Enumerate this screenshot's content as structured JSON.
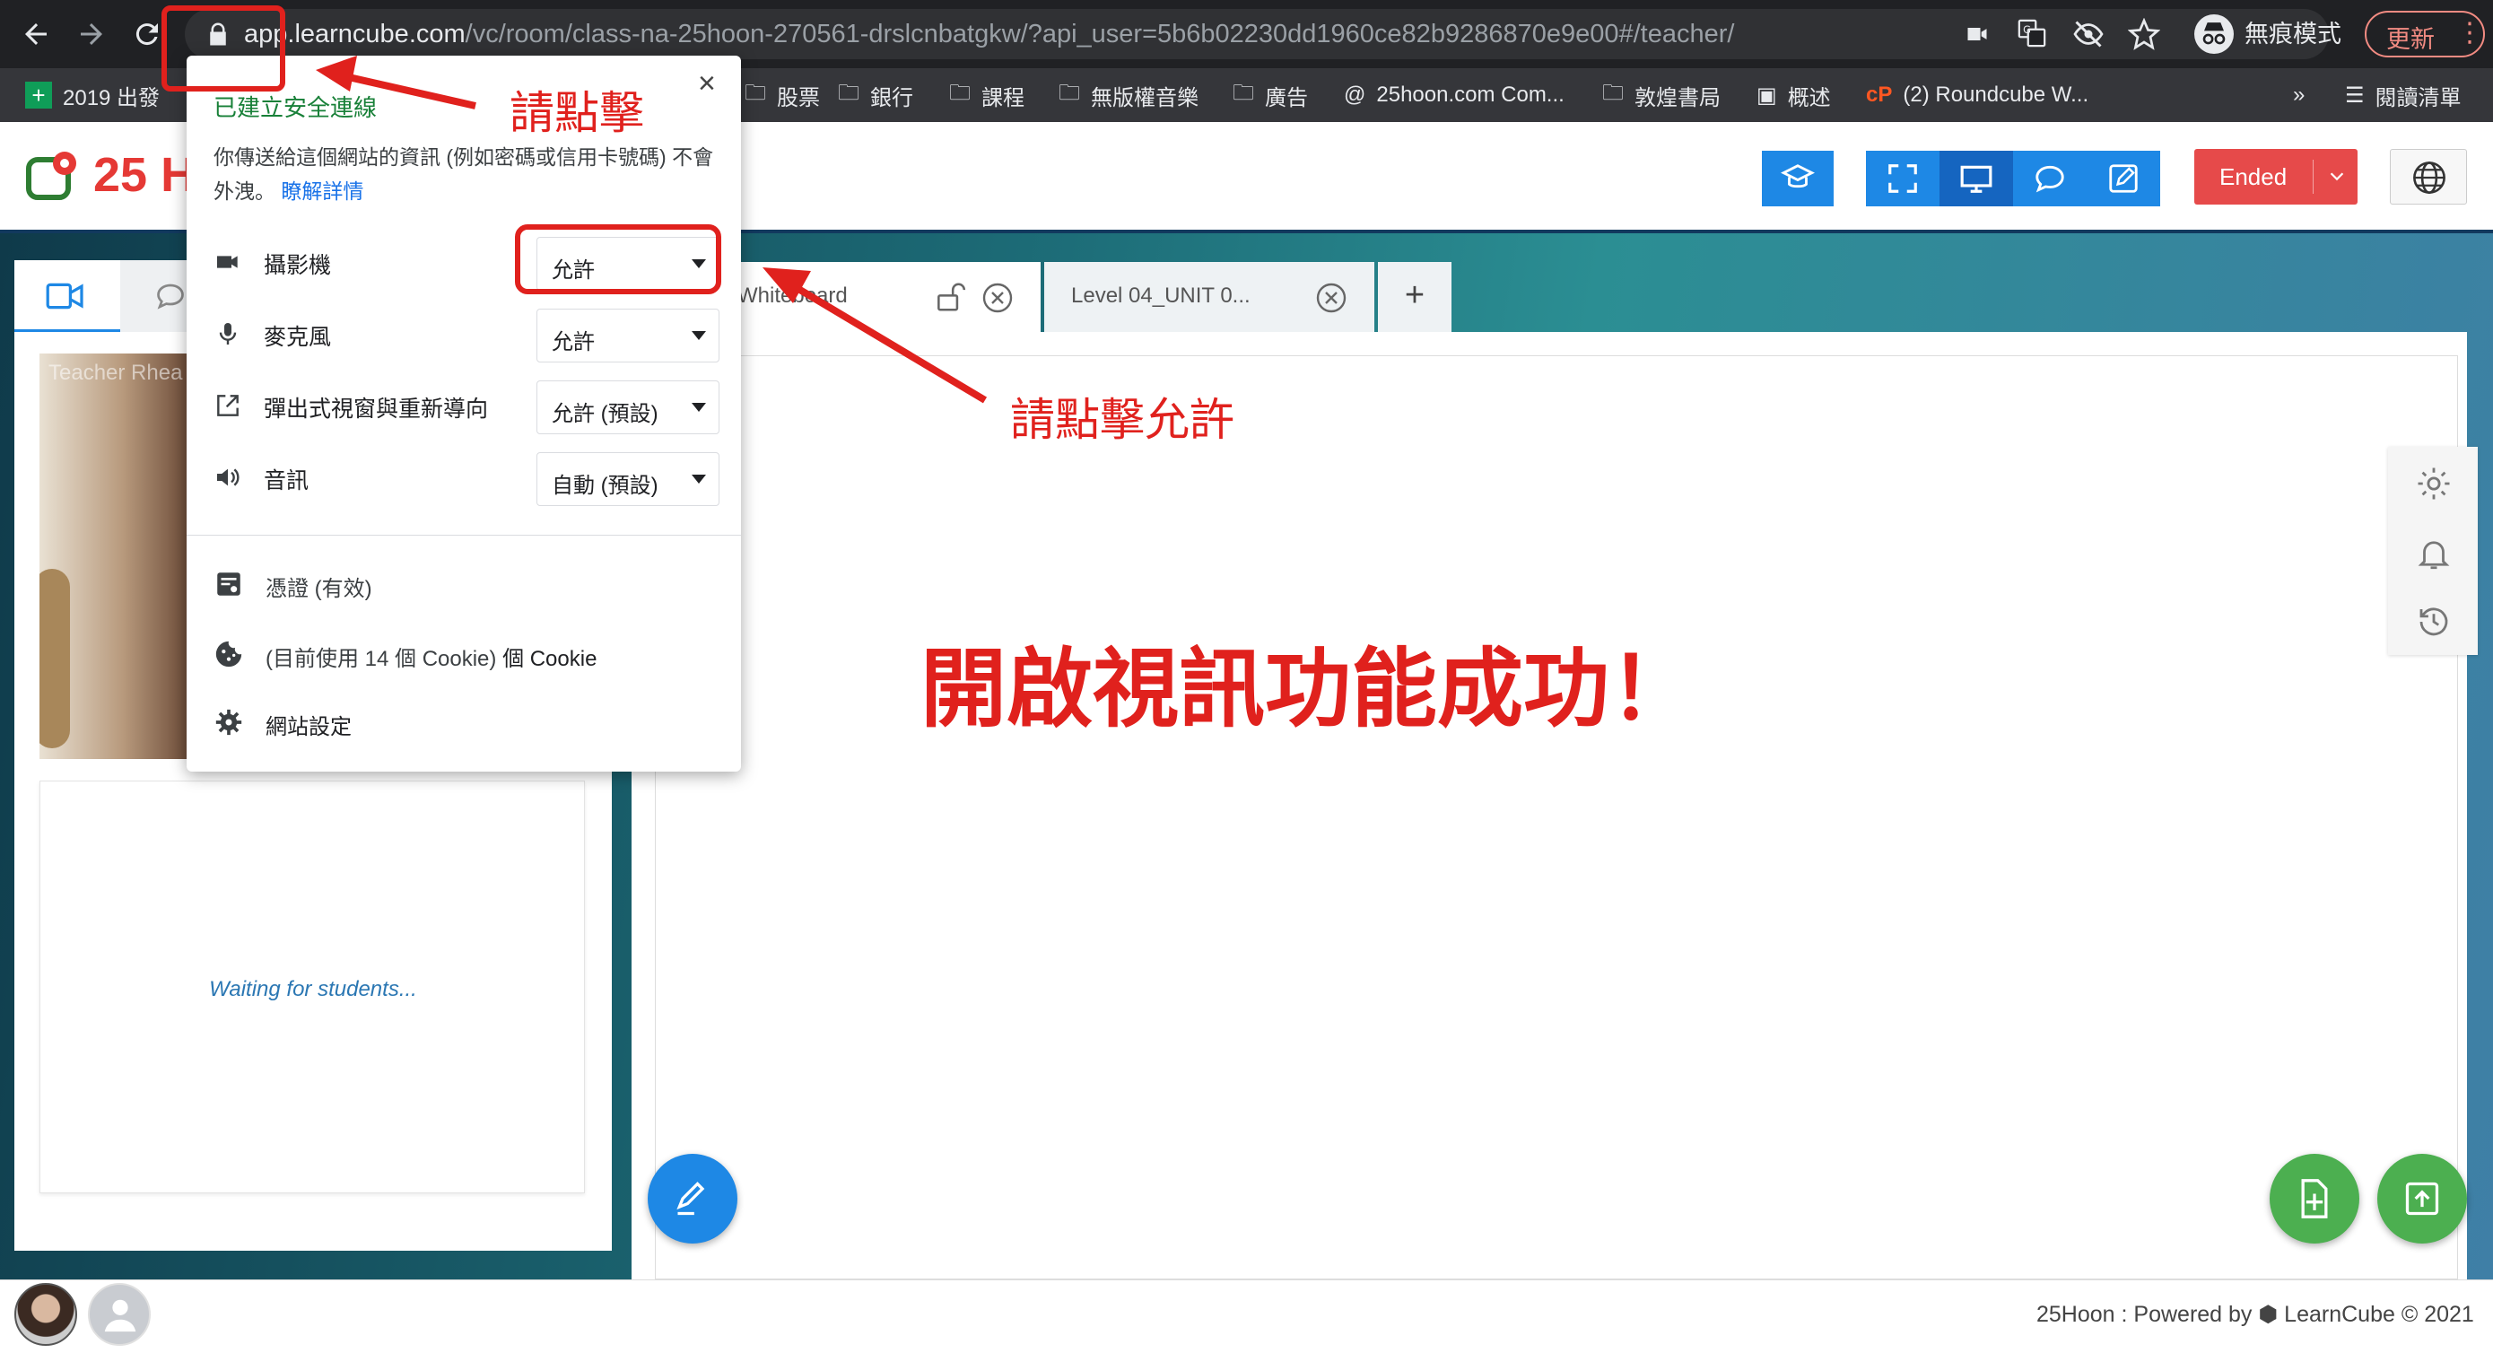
{
  "browser": {
    "url_host": "app.learncube.com",
    "url_path": "/vc/room/class-na-25hoon-270561-drslcnbatgkw/?api_user=5b6b02230dd1960ce82b9286870e9e00#/teacher/",
    "incognito_label": "無痕模式",
    "update_label": "更新",
    "bookmarks": [
      "2019 出發",
      "股票",
      "銀行",
      "課程",
      "無版權音樂",
      "廣告",
      "25hoon.com Com...",
      "敦煌書局",
      "概述",
      "(2) Roundcube W..."
    ],
    "overflow_label": "»",
    "reading_list_label": "閱讀清單"
  },
  "popup": {
    "title": "已建立安全連線",
    "description": "你傳送給這個網站的資訊 (例如密碼或信用卡號碼) 不會外洩。",
    "learn_more": "瞭解詳情",
    "permissions": [
      {
        "label": "攝影機",
        "value": "允許",
        "icon": "camera-icon"
      },
      {
        "label": "麥克風",
        "value": "允許",
        "icon": "microphone-icon"
      },
      {
        "label": "彈出式視窗與重新導向",
        "value": "允許 (預設)",
        "icon": "popup-icon"
      },
      {
        "label": "音訊",
        "value": "自動 (預設)",
        "icon": "speaker-icon"
      }
    ],
    "certificate": "憑證 (有效)",
    "cookies_prefix": "(目前使用 14 個 Cookie)",
    "cookies_suffix": "個 Cookie",
    "site_settings": "網站設定"
  },
  "app": {
    "logo_text": "25 H",
    "ended_label": "Ended",
    "tabs": [
      {
        "label": "Whiteboard"
      },
      {
        "label": "Level 04_UNIT 0..."
      }
    ],
    "add_tab": "+",
    "teacher_label": "Teacher Rhea",
    "waiting_text": "Waiting for students...",
    "footer_text": "25Hoon : Powered by ",
    "footer_brand": "LearnCube © 2021"
  },
  "annotations": {
    "click_here": "請點擊",
    "click_allow": "請點擊允許",
    "success": "開啟視訊功能成功！"
  },
  "colors": {
    "chrome_dark": "#202124",
    "accent_blue": "#1e88e5",
    "ended_red": "#e64a4a",
    "annotation_red": "#e0211d",
    "green_fab": "#4caf50"
  }
}
